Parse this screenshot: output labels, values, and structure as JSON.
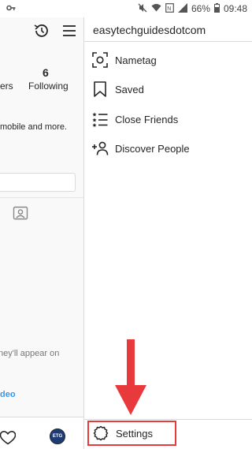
{
  "status_bar": {
    "battery": "66%",
    "time": "09:48",
    "icons": [
      "key-icon",
      "mute-icon",
      "wifi-icon",
      "nfc-icon",
      "signal-icon",
      "battery-icon"
    ]
  },
  "profile": {
    "following_count": "6",
    "followers_label_fragment": "ers",
    "following_label": "Following",
    "bio_fragment": "mobile and more.",
    "empty_state_fragment": "ney'll appear on",
    "video_link_fragment": "deo",
    "avatar_initials": "ETG"
  },
  "drawer": {
    "username": "easytechguidesdotcom",
    "items": [
      {
        "label": "Nametag",
        "icon": "nametag-icon"
      },
      {
        "label": "Saved",
        "icon": "bookmark-icon"
      },
      {
        "label": "Close Friends",
        "icon": "close-friends-icon"
      },
      {
        "label": "Discover People",
        "icon": "add-person-icon"
      }
    ],
    "settings_label": "Settings"
  },
  "colors": {
    "highlight": "#e8393d",
    "link": "#3897f0",
    "text": "#262626"
  }
}
